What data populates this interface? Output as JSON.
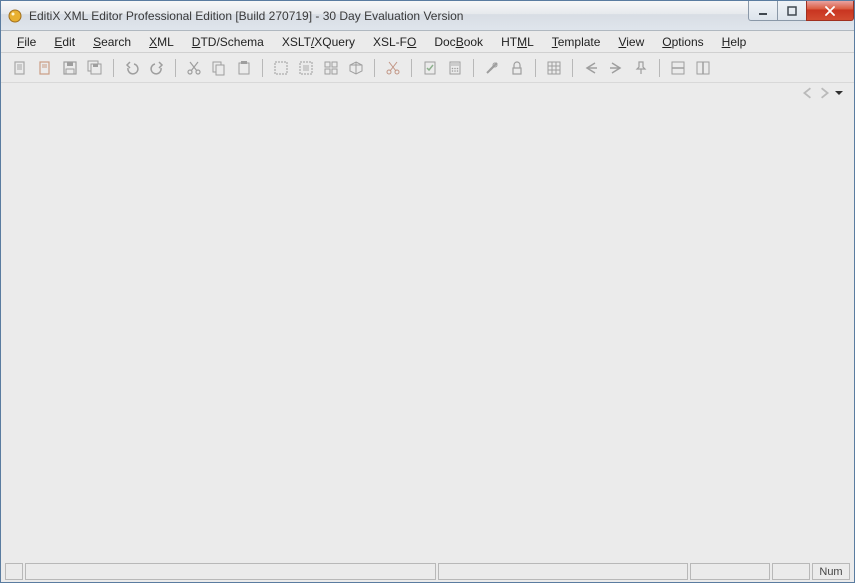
{
  "window": {
    "title": "EditiX XML Editor Professional Edition  [Build 270719] - 30 Day Evaluation Version"
  },
  "menubar": {
    "items": [
      {
        "label": "File",
        "ul": 0
      },
      {
        "label": "Edit",
        "ul": 0
      },
      {
        "label": "Search",
        "ul": 0
      },
      {
        "label": "XML",
        "ul": 0
      },
      {
        "label": "DTD/Schema",
        "ul": 0
      },
      {
        "label": "XSLT/XQuery",
        "ul": 4
      },
      {
        "label": "XSL-FO",
        "ul": 5
      },
      {
        "label": "DocBook",
        "ul": 3
      },
      {
        "label": "HTML",
        "ul": 2
      },
      {
        "label": "Template",
        "ul": 0
      },
      {
        "label": "View",
        "ul": 0
      },
      {
        "label": "Options",
        "ul": 0
      },
      {
        "label": "Help",
        "ul": 0
      }
    ]
  },
  "toolbar": {
    "groups": [
      [
        "new-doc",
        "open-doc",
        "save",
        "save-all"
      ],
      [
        "undo",
        "redo"
      ],
      [
        "cut",
        "copy",
        "paste"
      ],
      [
        "select-elem",
        "select-content",
        "select-block",
        "cube"
      ],
      [
        "cut-elem"
      ],
      [
        "validate",
        "calc"
      ],
      [
        "tools",
        "lock"
      ],
      [
        "grid"
      ],
      [
        "nav-back",
        "nav-fwd",
        "pin"
      ],
      [
        "split-h",
        "split-v"
      ]
    ]
  },
  "statusbar": {
    "num_label": "Num"
  }
}
